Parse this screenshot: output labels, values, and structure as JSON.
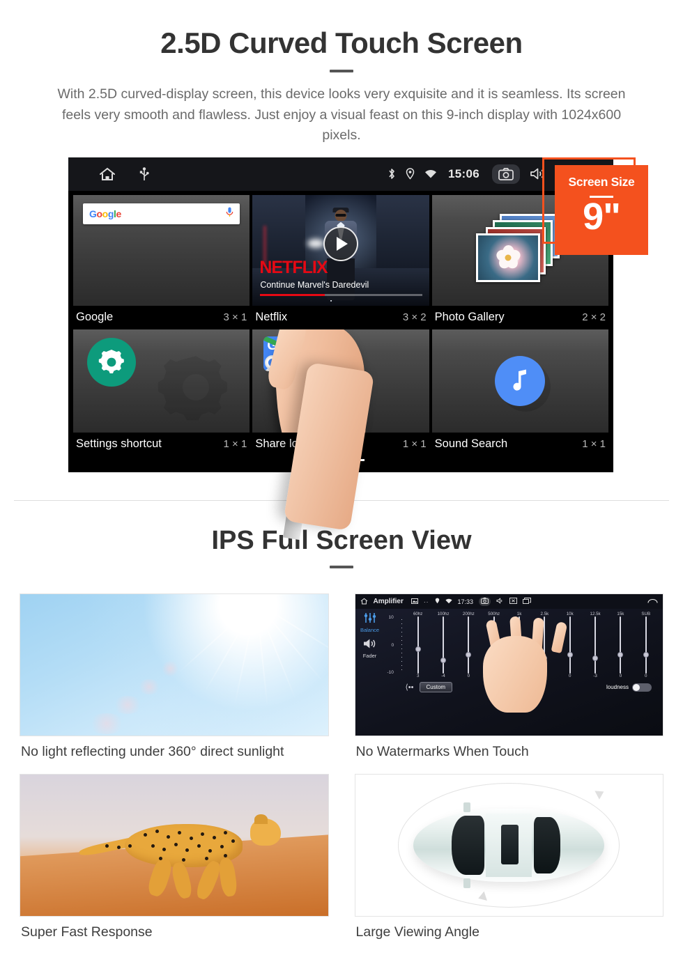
{
  "section1": {
    "title": "2.5D Curved Touch Screen",
    "subtitle": "With 2.5D curved-display screen, this device looks very exquisite and it is seamless. Its screen feels very smooth and flawless. Just enjoy a visual feast on this 9-inch display with 1024x600 pixels.",
    "badge": {
      "label": "Screen Size",
      "value": "9\"",
      "color": "#f4511e"
    },
    "device": {
      "statusbar": {
        "clock": "15:06",
        "left_icons": [
          "home-icon",
          "usb-icon"
        ],
        "right_icons": [
          "bluetooth-icon",
          "location-icon",
          "wifi-icon",
          "screenshot-icon",
          "volume-icon",
          "close-icon",
          "recent-apps-icon"
        ]
      },
      "widgets": [
        {
          "name": "Google",
          "size": "3 × 1",
          "icon": "google-search-bar",
          "placeholder": "Google"
        },
        {
          "name": "Netflix",
          "size": "3 × 2",
          "icon": "netflix-preview",
          "logo": "NETFLIX",
          "caption": "Continue Marvel's Daredevil"
        },
        {
          "name": "Photo Gallery",
          "size": "2 × 2",
          "icon": "photo-stack-icon"
        },
        {
          "name": "Settings shortcut",
          "size": "1 × 1",
          "icon": "gear-icon"
        },
        {
          "name": "Share location",
          "size": "1 × 1",
          "icon": "google-maps-icon"
        },
        {
          "name": "Sound Search",
          "size": "1 × 1",
          "icon": "music-note-icon"
        }
      ],
      "page_indicator": {
        "count": 3,
        "active": 3
      }
    }
  },
  "section2": {
    "title": "IPS Full Screen View",
    "cards": [
      {
        "caption": "No light reflecting under 360° direct sunlight",
        "image": "sunlight-sky-photo"
      },
      {
        "caption": "No Watermarks When Touch",
        "image": "amplifier-equalizer-screen"
      },
      {
        "caption": "Super Fast Response",
        "image": "running-cheetah-photo"
      },
      {
        "caption": "Large Viewing Angle",
        "image": "car-top-view-diagram"
      }
    ]
  },
  "amplifier": {
    "title": "Amplifier",
    "clock": "17:33",
    "side": {
      "balance": "Balance",
      "fader": "Fader"
    },
    "scale": {
      "max": "10",
      "mid": "0",
      "min": "-10"
    },
    "bands": [
      "60hz",
      "100hz",
      "200hz",
      "500hz",
      "1k",
      "2.5k",
      "10k",
      "12.5k",
      "15k",
      "SUB"
    ],
    "values": [
      "3",
      "-4",
      "0",
      "0",
      "0",
      "-3",
      "0",
      "-3",
      "0",
      "0"
    ],
    "preset_button": "Custom",
    "loudness_label": "loudness",
    "loudness_on": false,
    "back_icon": "back-arrow-icon"
  }
}
